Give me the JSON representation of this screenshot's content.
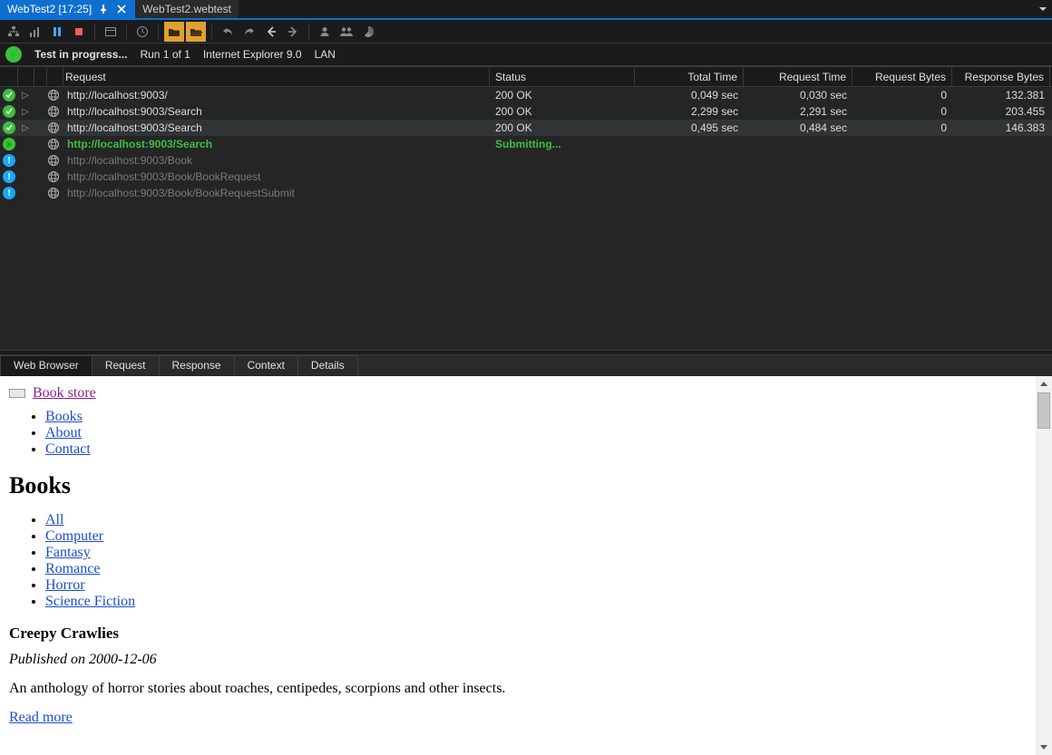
{
  "docTabs": {
    "active": "WebTest2 [17:25]",
    "inactive": "WebTest2.webtest"
  },
  "toolbar": {
    "icons": [
      "tree-icon",
      "water-icon",
      "pause-icon",
      "stop-icon",
      "http-icon",
      "clock-icon",
      "folder-open-icon",
      "folder-closed-icon",
      "refresh-icon",
      "redo-icon",
      "back-icon",
      "forward-icon",
      "person-icon",
      "people-icon",
      "pie-icon"
    ]
  },
  "statusLine": {
    "title": "Test in progress...",
    "run": "Run 1 of 1",
    "browser": "Internet Explorer 9.0",
    "network": "LAN"
  },
  "grid": {
    "headers": {
      "request": "Request",
      "status": "Status",
      "totalTime": "Total Time",
      "requestTime": "Request Time",
      "requestBytes": "Request Bytes",
      "responseBytes": "Response Bytes"
    },
    "rows": [
      {
        "state": "ok",
        "expandable": true,
        "url": "http://localhost:9003/",
        "status": "200 OK",
        "total": "0,049 sec",
        "req": "0,030 sec",
        "reqb": "0",
        "resb": "132.381"
      },
      {
        "state": "ok",
        "expandable": true,
        "url": "http://localhost:9003/Search",
        "status": "200 OK",
        "total": "2,299 sec",
        "req": "2,291 sec",
        "reqb": "0",
        "resb": "203.455"
      },
      {
        "state": "ok",
        "expandable": true,
        "selected": true,
        "url": "http://localhost:9003/Search",
        "status": "200 OK",
        "total": "0,495 sec",
        "req": "0,484 sec",
        "reqb": "0",
        "resb": "146.383"
      },
      {
        "state": "run",
        "expandable": false,
        "url": "http://localhost:9003/Search",
        "status": "Submitting...",
        "total": "",
        "req": "",
        "reqb": "",
        "resb": ""
      },
      {
        "state": "info",
        "expandable": false,
        "url": "http://localhost:9003/Book",
        "status": "",
        "total": "",
        "req": "",
        "reqb": "",
        "resb": ""
      },
      {
        "state": "info",
        "expandable": false,
        "url": "http://localhost:9003/Book/BookRequest",
        "status": "",
        "total": "",
        "req": "",
        "reqb": "",
        "resb": ""
      },
      {
        "state": "info",
        "expandable": false,
        "url": "http://localhost:9003/Book/BookRequestSubmit",
        "status": "",
        "total": "",
        "req": "",
        "reqb": "",
        "resb": ""
      }
    ]
  },
  "bottomTabs": [
    "Web Browser",
    "Request",
    "Response",
    "Context",
    "Details"
  ],
  "page": {
    "siteTitle": "Book store",
    "nav": [
      "Books",
      "About",
      "Contact"
    ],
    "heading": "Books",
    "categories": [
      "All",
      "Computer",
      "Fantasy",
      "Romance",
      "Horror",
      "Science Fiction"
    ],
    "book": {
      "title": "Creepy Crawlies",
      "published": "Published on 2000-12-06",
      "description": "An anthology of horror stories about roaches, centipedes, scorpions and other insects.",
      "readMore": "Read more"
    }
  }
}
